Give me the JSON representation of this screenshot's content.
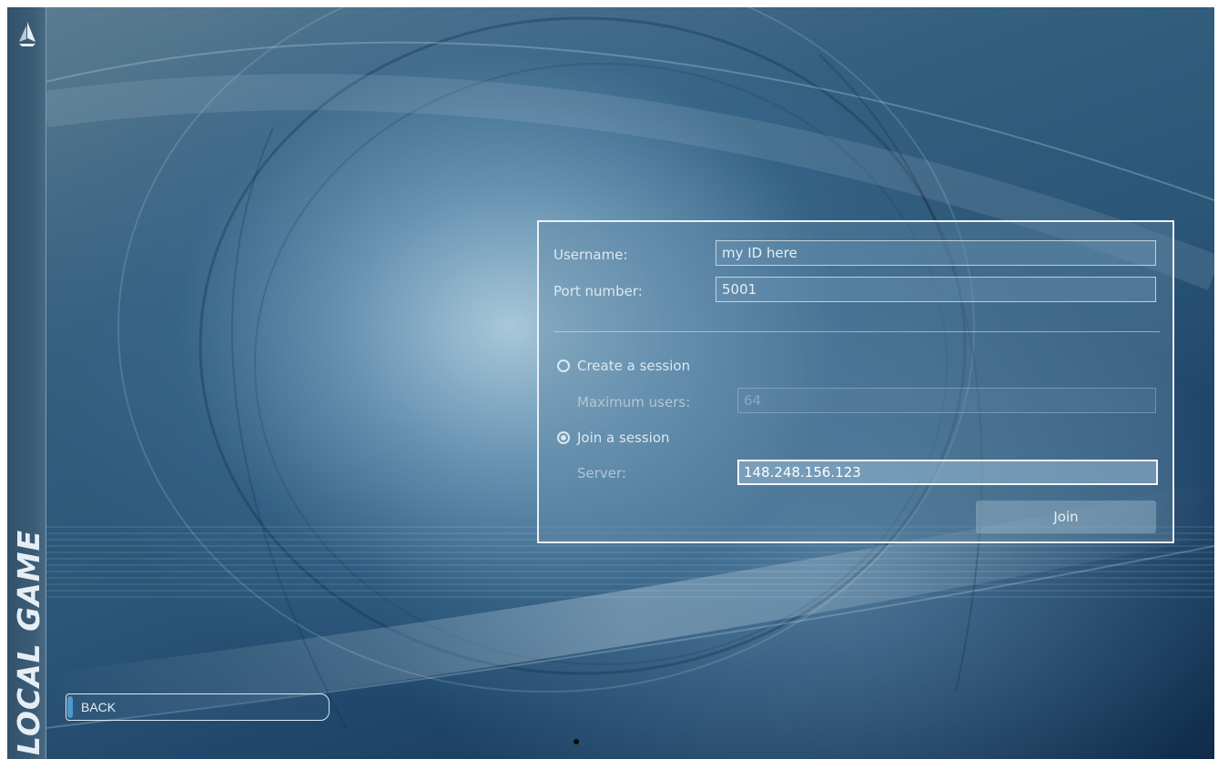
{
  "sidebar": {
    "title": "LOCAL GAME",
    "logo_icon": "sail-logo-icon"
  },
  "form": {
    "username_label": "Username:",
    "username_value": "my ID here",
    "port_label": "Port number:",
    "port_value": "5001",
    "create_session_label": "Create a session",
    "create_session_selected": false,
    "max_users_label": "Maximum users:",
    "max_users_value": "64",
    "join_session_label": "Join a session",
    "join_session_selected": true,
    "server_label": "Server:",
    "server_value": "148.248.156.123",
    "join_button_label": "Join"
  },
  "back_button": {
    "label": "BACK"
  },
  "colors": {
    "panel_border": "#e9f0f5",
    "accent": "#4d9ad0",
    "text": "#dce8f0"
  }
}
